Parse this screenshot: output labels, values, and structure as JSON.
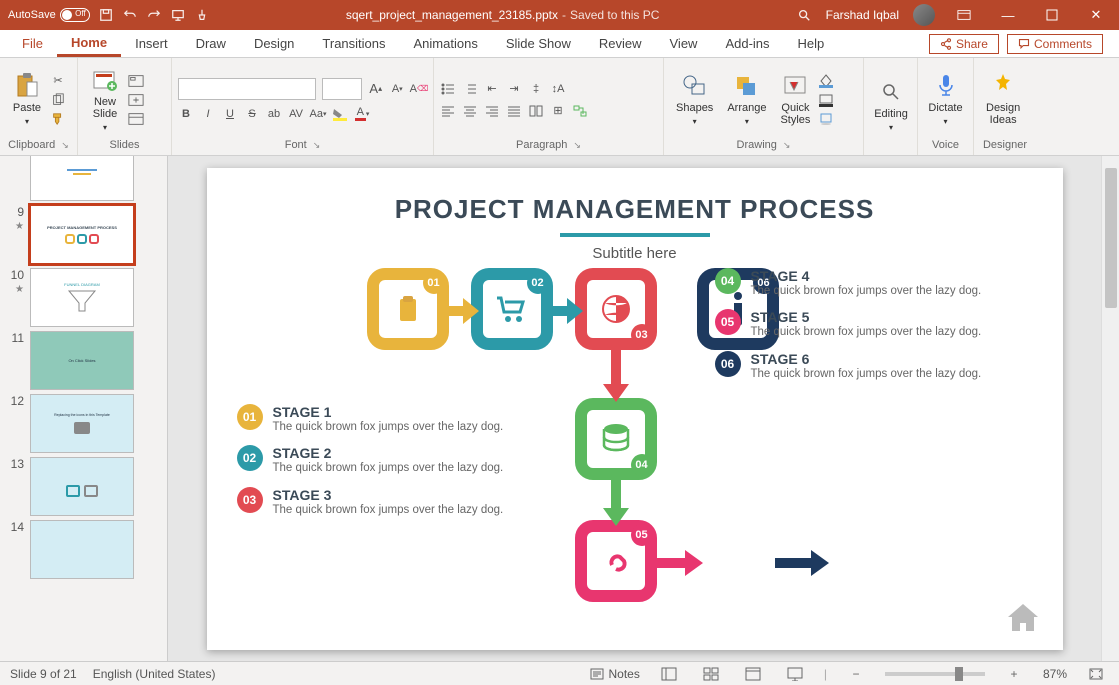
{
  "titlebar": {
    "autosave": "AutoSave",
    "autosave_state": "Off",
    "filename": "sqert_project_management_23185.pptx",
    "saved_status": "Saved to this PC",
    "user_name": "Farshad Iqbal"
  },
  "tabs": {
    "file": "File",
    "home": "Home",
    "insert": "Insert",
    "draw": "Draw",
    "design": "Design",
    "transitions": "Transitions",
    "animations": "Animations",
    "slideshow": "Slide Show",
    "review": "Review",
    "view": "View",
    "addins": "Add-ins",
    "help": "Help",
    "share": "Share",
    "comments": "Comments"
  },
  "ribbon": {
    "clipboard": {
      "label": "Clipboard",
      "paste": "Paste"
    },
    "slides": {
      "label": "Slides",
      "new_slide": "New\nSlide"
    },
    "font": {
      "label": "Font"
    },
    "paragraph": {
      "label": "Paragraph"
    },
    "drawing": {
      "label": "Drawing",
      "shapes": "Shapes",
      "arrange": "Arrange",
      "quick_styles": "Quick\nStyles"
    },
    "editing": {
      "label": "Editing"
    },
    "voice": {
      "label": "Voice",
      "dictate": "Dictate"
    },
    "designer": {
      "label": "Designer",
      "design_ideas": "Design\nIdeas"
    }
  },
  "thumbnails": {
    "visible": [
      "9",
      "10",
      "11",
      "12",
      "13",
      "14"
    ],
    "selected": "9"
  },
  "slide": {
    "title": "PROJECT MANAGEMENT PROCESS",
    "subtitle": "Subtitle here",
    "stages_left": [
      {
        "num": "01",
        "color": "c-yellow",
        "title": "STAGE 1",
        "desc": "The quick brown fox jumps over the lazy dog."
      },
      {
        "num": "02",
        "color": "c-teal",
        "title": "STAGE 2",
        "desc": "The quick brown fox jumps over the lazy dog."
      },
      {
        "num": "03",
        "color": "c-red",
        "title": "STAGE 3",
        "desc": "The quick brown fox jumps over the lazy dog."
      }
    ],
    "stages_right": [
      {
        "num": "04",
        "color": "c-green",
        "title": "STAGE 4",
        "desc": "The quick brown fox jumps over the lazy dog."
      },
      {
        "num": "05",
        "color": "c-pink",
        "title": "STAGE 5",
        "desc": "The quick brown fox jumps over the lazy dog."
      },
      {
        "num": "06",
        "color": "c-navy",
        "title": "STAGE 6",
        "desc": "The quick brown fox jumps over the lazy dog."
      }
    ],
    "flow_badges": [
      "01",
      "02",
      "03",
      "04",
      "05",
      "06"
    ]
  },
  "statusbar": {
    "slide_count": "Slide 9 of 21",
    "language": "English (United States)",
    "notes": "Notes",
    "zoom": "87%"
  }
}
